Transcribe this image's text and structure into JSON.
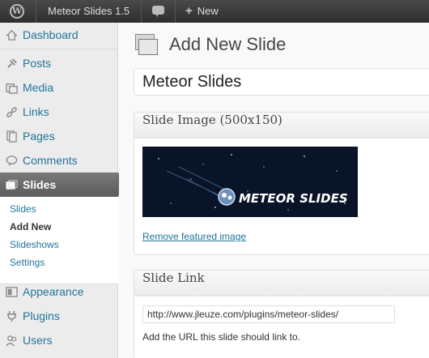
{
  "admin_bar": {
    "logo_glyph": "W",
    "site_name": "Meteor Slides 1.5",
    "new_label": "New",
    "plus_glyph": "+"
  },
  "sidebar": {
    "items": [
      {
        "label": "Dashboard",
        "icon": "dashboard-icon"
      },
      {
        "label": "Posts",
        "icon": "pin-icon"
      },
      {
        "label": "Media",
        "icon": "media-icon"
      },
      {
        "label": "Links",
        "icon": "link-icon"
      },
      {
        "label": "Pages",
        "icon": "pages-icon"
      },
      {
        "label": "Comments",
        "icon": "comment-icon"
      },
      {
        "label": "Slides",
        "icon": "slides-icon"
      },
      {
        "label": "Appearance",
        "icon": "appearance-icon"
      },
      {
        "label": "Plugins",
        "icon": "plugin-icon"
      },
      {
        "label": "Users",
        "icon": "users-icon"
      }
    ],
    "submenu": [
      "Slides",
      "Add New",
      "Slideshows",
      "Settings"
    ],
    "active_sub": "Add New"
  },
  "main": {
    "page_title": "Add New Slide",
    "title_value": "Meteor Slides",
    "image_box": {
      "title": "Slide Image (500x150)",
      "preview_text": "METEOR SLIDES",
      "remove_link": "Remove featured image"
    },
    "link_box": {
      "title": "Slide Link",
      "url_value": "http://www.jleuze.com/plugins/meteor-slides/",
      "help": "Add the URL this slide should link to."
    }
  },
  "colors": {
    "link": "#21759b",
    "admin_bar": "#333333",
    "active_menu": "#6b6b6b",
    "preview_bg": "#0a1428"
  }
}
